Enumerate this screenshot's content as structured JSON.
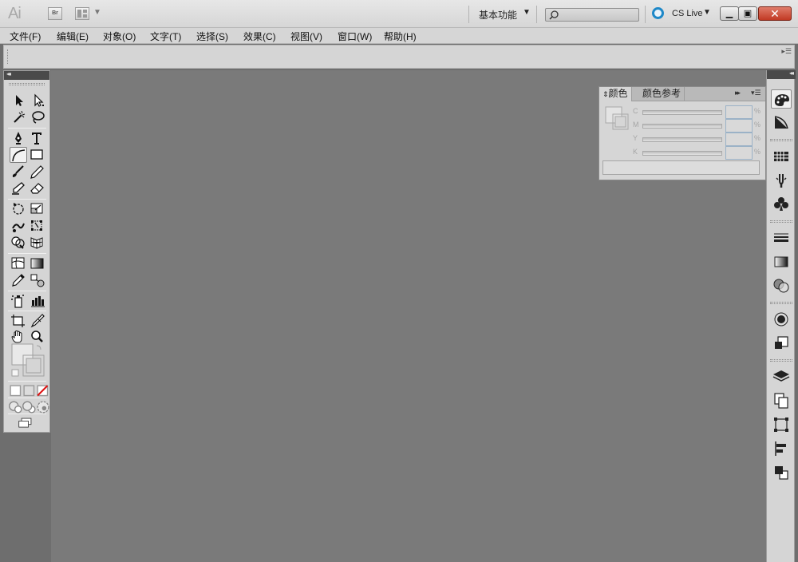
{
  "app": {
    "logo_text": "Ai",
    "bridge_label": "Br",
    "workspace_label": "基本功能",
    "search_placeholder": "",
    "cslive_label": "CS Live",
    "colors": {
      "cslive_blue": "#1e88c8",
      "close_red": "#c13a24",
      "canvas_gray": "#7a7a7a",
      "panel_gray": "#d5d5d5"
    }
  },
  "menu": [
    {
      "label": "文件(F)"
    },
    {
      "label": "编辑(E)"
    },
    {
      "label": "对象(O)"
    },
    {
      "label": "文字(T)"
    },
    {
      "label": "选择(S)"
    },
    {
      "label": "效果(C)"
    },
    {
      "label": "视图(V)"
    },
    {
      "label": "窗口(W)"
    },
    {
      "label": "帮助(H)"
    }
  ],
  "color_panel": {
    "tab_color": "颜色",
    "tab_guide": "颜色参考",
    "channels": [
      "C",
      "M",
      "Y",
      "K"
    ],
    "percent": "%"
  },
  "icons": {
    "tools": [
      "selection-icon",
      "direct-selection-icon",
      "magic-wand-icon",
      "lasso-icon",
      "pen-icon",
      "type-icon",
      "arc-icon",
      "rectangle-icon",
      "paintbrush-icon",
      "pencil-icon",
      "blob-brush-icon",
      "eraser-icon",
      "rotate-icon",
      "scale-icon",
      "warp-icon",
      "free-transform-icon",
      "shape-builder-icon",
      "perspective-grid-icon",
      "mesh-icon",
      "gradient-icon",
      "eyedropper-icon",
      "blend-icon",
      "symbol-sprayer-icon",
      "column-graph-icon",
      "artboard-icon",
      "slice-icon",
      "hand-icon",
      "zoom-icon"
    ],
    "dock": [
      "color-icon",
      "color-guide-icon",
      "swatches-icon",
      "brushes-icon",
      "symbols-icon",
      "stroke-icon",
      "gradient-panel-icon",
      "transparency-icon",
      "appearance-icon",
      "graphic-styles-icon",
      "layers-icon",
      "artboards-icon",
      "transform-icon",
      "align-icon",
      "pathfinder-icon"
    ]
  }
}
